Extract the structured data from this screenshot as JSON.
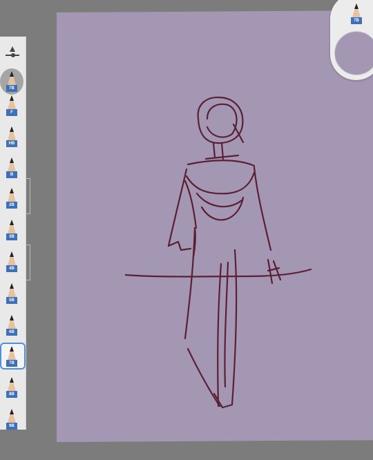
{
  "brushes": [
    {
      "label": "7B"
    },
    {
      "label": "F"
    },
    {
      "label": "HB"
    },
    {
      "label": "B"
    },
    {
      "label": "2B"
    },
    {
      "label": "3B"
    },
    {
      "label": "4B"
    },
    {
      "label": "5B"
    },
    {
      "label": "6B"
    },
    {
      "label": "7B"
    },
    {
      "label": "8B"
    },
    {
      "label": "9B"
    }
  ],
  "active_brush": {
    "label": "7B"
  },
  "colors": {
    "canvas": "#a497b4",
    "stroke": "#5a1f33",
    "background": "#7c7c7c",
    "toolbar": "#e9e9e9",
    "accent": "#4e8fe0"
  },
  "icons": {
    "size_slider": "size-slider-icon",
    "pencil": "pencil-icon"
  }
}
